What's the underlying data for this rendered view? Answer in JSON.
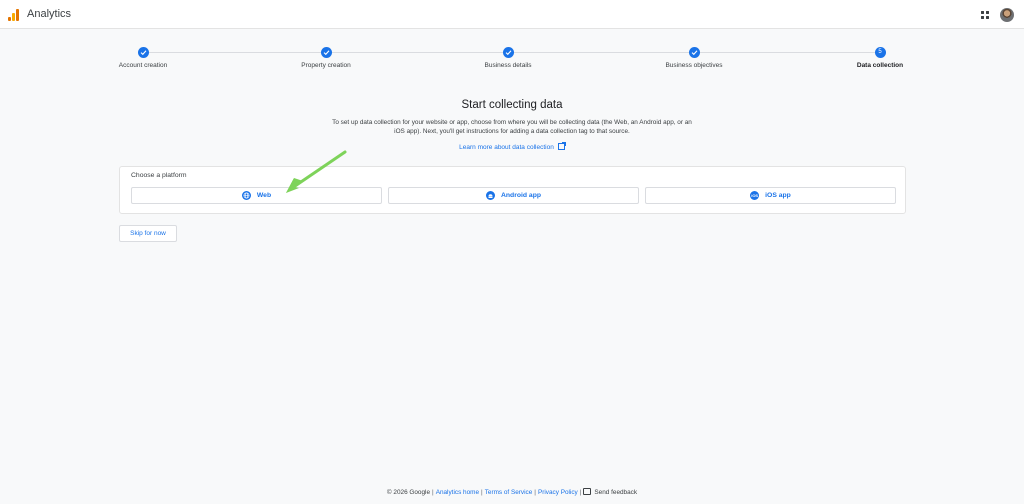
{
  "app": {
    "title": "Analytics"
  },
  "steps": [
    {
      "label": "Account creation",
      "status": "done"
    },
    {
      "label": "Property creation",
      "status": "done"
    },
    {
      "label": "Business details",
      "status": "done"
    },
    {
      "label": "Business objectives",
      "status": "done"
    },
    {
      "label": "Data collection",
      "status": "active",
      "number": "5"
    }
  ],
  "main": {
    "heading": "Start collecting data",
    "description": "To set up data collection for your website or app, choose from where you will be collecting data (the Web, an Android app, or an iOS app). Next, you'll get instructions for adding a data collection tag to that source.",
    "learn_more": "Learn more about data collection"
  },
  "platform": {
    "title": "Choose a platform",
    "options": [
      {
        "label": "Web",
        "icon": "globe-icon"
      },
      {
        "label": "Android app",
        "icon": "android-icon"
      },
      {
        "label": "iOS app",
        "icon": "ios-icon",
        "icon_text": "iOS"
      }
    ]
  },
  "skip_label": "Skip for now",
  "footer": {
    "copyright": "© 2026 Google",
    "analytics_home": "Analytics home",
    "terms": "Terms of Service",
    "privacy": "Privacy Policy",
    "feedback": "Send feedback"
  },
  "colors": {
    "accent": "#1a73e8",
    "annotation_arrow": "#7ed35a"
  }
}
